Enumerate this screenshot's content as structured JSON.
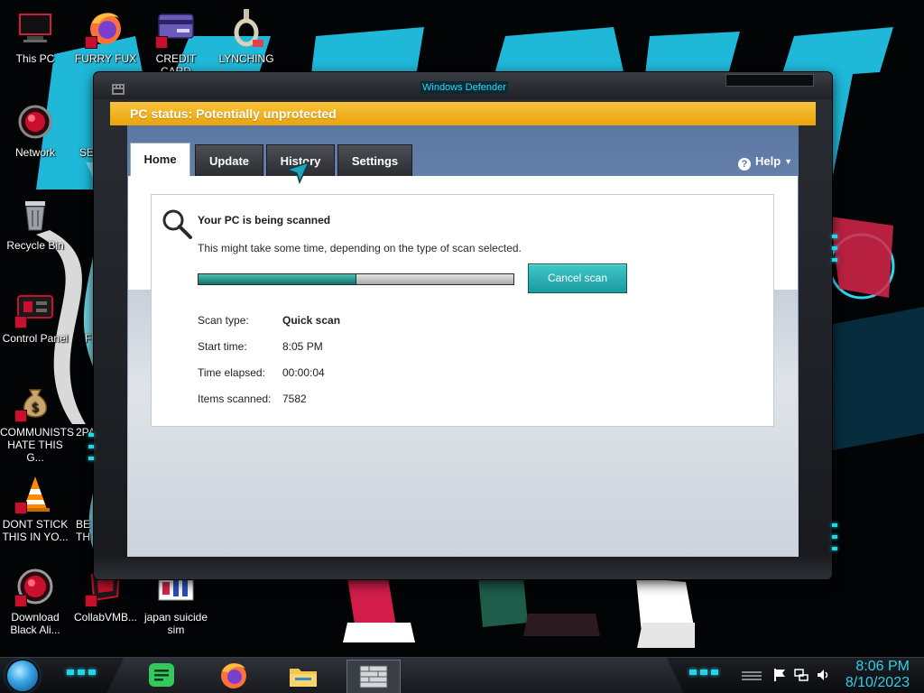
{
  "desktop": {
    "icons_left": [
      {
        "label": "This PC"
      },
      {
        "label": "Network"
      },
      {
        "label": "Recycle Bin"
      },
      {
        "label": "Control Panel"
      },
      {
        "label": "COMMUNISTS HATE THIS G..."
      },
      {
        "label": "DONT STICK THIS IN YO..."
      },
      {
        "label": "Download Black Ali..."
      }
    ],
    "icons_top": [
      {
        "label": "FURRY FUX"
      },
      {
        "label": "CREDIT CARD CHECKER"
      },
      {
        "label": "LYNCHING"
      }
    ],
    "icons_second_column": [
      {
        "label": "SEX"
      },
      {
        "label": "FL"
      },
      {
        "label": "2PA"
      },
      {
        "label": "BE TH"
      }
    ],
    "icons_bottom": [
      {
        "label": "CollabVMB..."
      },
      {
        "label": "japan suicide sim"
      }
    ]
  },
  "window": {
    "title": "Windows Defender",
    "status": "PC status: Potentially unprotected",
    "status_color": "#f2b01e",
    "accent_color": "#2bb5b8",
    "tabs": [
      {
        "label": "Home",
        "active": true
      },
      {
        "label": "Update",
        "active": false
      },
      {
        "label": "History",
        "active": false
      },
      {
        "label": "Settings",
        "active": false
      }
    ],
    "help": {
      "label": "Help",
      "icon": "question-icon"
    },
    "scan": {
      "heading": "Your PC is being scanned",
      "description": "This might take some time, depending on the type of scan selected.",
      "progress": 0.5,
      "cancel_label": "Cancel scan",
      "details": [
        {
          "label": "Scan type:",
          "value": "Quick scan",
          "bold": true
        },
        {
          "label": "Start time:",
          "value": "8:05 PM",
          "bold": false
        },
        {
          "label": "Time elapsed:",
          "value": "00:00:04",
          "bold": false
        },
        {
          "label": "Items scanned:",
          "value": "7582",
          "bold": false
        }
      ]
    }
  },
  "taskbar": {
    "pinned": [
      {
        "name": "spotify-app",
        "icon": "chat-bubble-icon",
        "color": "#35c85b"
      },
      {
        "name": "firefox-app",
        "icon": "firefox-icon",
        "color": "#ff7139"
      },
      {
        "name": "file-explorer-app",
        "icon": "folder-icon",
        "color": "#f3c54a"
      },
      {
        "name": "defender-app",
        "icon": "firewall-icon",
        "color": "#cfd3d8"
      }
    ],
    "tray": [
      "flag-icon",
      "network-icon",
      "volume-icon"
    ],
    "clock": {
      "time": "8:06 PM",
      "date": "8/10/2023"
    }
  }
}
